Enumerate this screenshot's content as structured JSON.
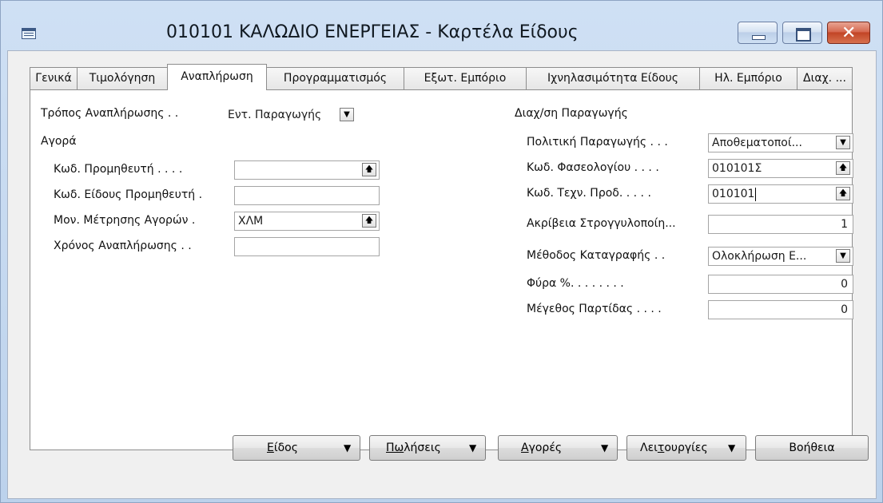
{
  "window": {
    "title": "010101 ΚΑΛΩΔΙΟ ΕΝΕΡΓΕΙΑΣ - Καρτέλα Είδους",
    "close_glyph": "✕"
  },
  "tabs": [
    {
      "label": "Γενικά"
    },
    {
      "label": "Τιμολόγηση"
    },
    {
      "label": "Αναπλήρωση"
    },
    {
      "label": "Προγραμματισμός"
    },
    {
      "label": "Εξωτ. Εμπόριο"
    },
    {
      "label": "Ιχνηλασιμότητα Είδους"
    },
    {
      "label": "Ηλ. Εμπόριο"
    },
    {
      "label": "Διαχ. ..."
    }
  ],
  "active_tab": "Αναπλήρωση",
  "left": {
    "replenishment_method": {
      "label": "Τρόπος Αναπλήρωσης . .",
      "value": "Εντ. Παραγωγής"
    },
    "purchase_heading": "Αγορά",
    "vendor_no": {
      "label": "Κωδ. Προμηθευτή . . . .",
      "value": ""
    },
    "vendor_item_no": {
      "label": "Κωδ. Είδους Προμηθευτή .",
      "value": ""
    },
    "purch_uom": {
      "label": "Μον. Μέτρησης Αγορών .",
      "value": "ΧΛΜ"
    },
    "lead_time": {
      "label": "Χρόνος Αναπλήρωσης . .",
      "value": ""
    }
  },
  "right": {
    "heading": "Διαχ/ση Παραγωγής",
    "manufacturing_policy": {
      "label": "Πολιτική Παραγωγής . . .",
      "value": "Αποθεματοποί..."
    },
    "routing_no": {
      "label": "Κωδ. Φασεολογίου . . . .",
      "value": "010101Σ"
    },
    "bom_no": {
      "label": "Κωδ. Τεχν. Προδ. . . . .",
      "value": "010101"
    },
    "rounding_precision": {
      "label": "Ακρίβεια Στρογγυλοποίη...",
      "value": "1"
    },
    "flushing_method": {
      "label": "Μέθοδος Καταγραφής . .",
      "value": "Ολοκλήρωση Ε..."
    },
    "scrap": {
      "label": "Φύρα %. . . . . . . .",
      "value": "0"
    },
    "lot_size": {
      "label": "Μέγεθος Παρτίδας . . . .",
      "value": "0"
    }
  },
  "buttons": {
    "item": {
      "pre": "",
      "mnemonic": "Ε",
      "post": "ίδος"
    },
    "sales": {
      "pre": "",
      "mnemonic": "Πω",
      "post": "λήσεις"
    },
    "purchases": {
      "pre": "",
      "mnemonic": "Α",
      "post": "γορές"
    },
    "functions": {
      "pre": "Λει",
      "mnemonic": "τ",
      "post": "ουργίες"
    },
    "help": {
      "label": "Βοήθεια"
    }
  },
  "icons": {
    "dropdown": "▼",
    "lookup": "🡅"
  },
  "colors": {
    "title_bar": "#cfe0f4",
    "close_button": "#c24526",
    "panel": "#ffffff"
  }
}
